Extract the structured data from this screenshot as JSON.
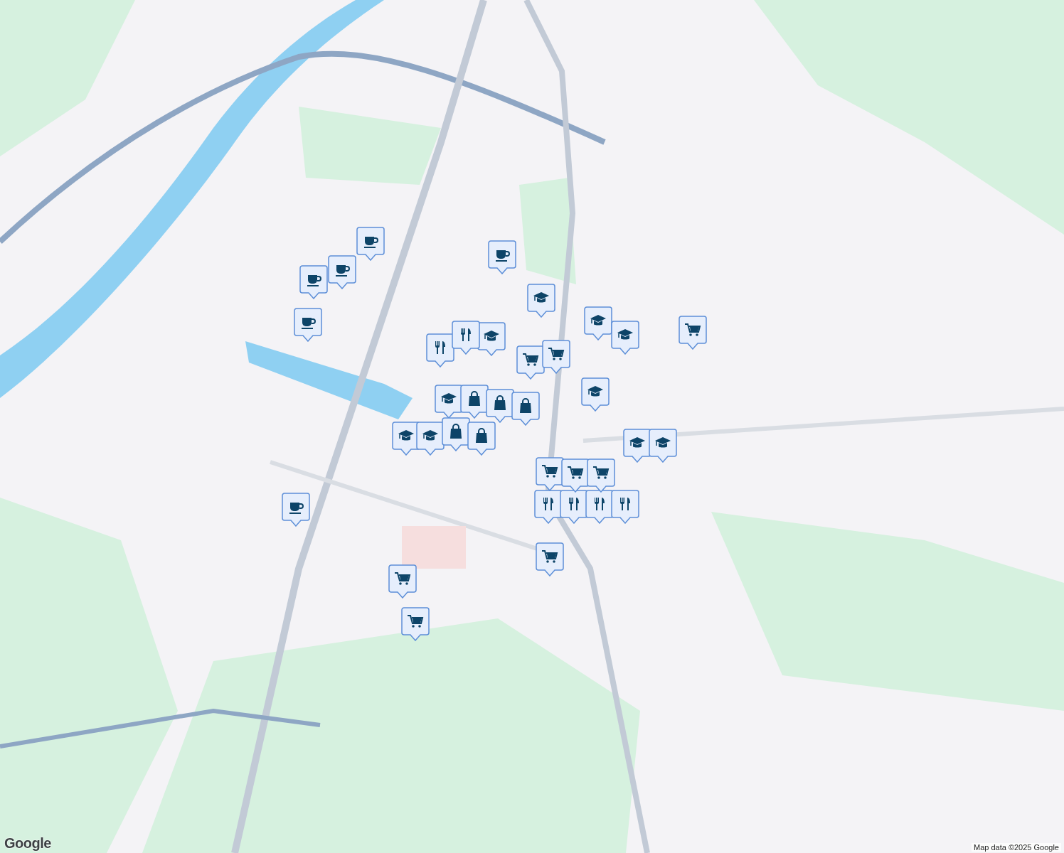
{
  "map": {
    "pins": [
      {
        "kind": "cafe"
      },
      {
        "kind": "cafe"
      },
      {
        "kind": "cafe"
      },
      {
        "kind": "cafe"
      },
      {
        "kind": "cafe"
      },
      {
        "kind": "cafe"
      },
      {
        "kind": "school"
      },
      {
        "kind": "school"
      },
      {
        "kind": "school"
      },
      {
        "kind": "school"
      },
      {
        "kind": "school"
      },
      {
        "kind": "school"
      },
      {
        "kind": "school"
      },
      {
        "kind": "school"
      },
      {
        "kind": "school"
      },
      {
        "kind": "school"
      },
      {
        "kind": "restaurant"
      },
      {
        "kind": "restaurant"
      },
      {
        "kind": "restaurant"
      },
      {
        "kind": "restaurant"
      },
      {
        "kind": "restaurant"
      },
      {
        "kind": "restaurant"
      },
      {
        "kind": "grocery"
      },
      {
        "kind": "grocery"
      },
      {
        "kind": "grocery"
      },
      {
        "kind": "grocery"
      },
      {
        "kind": "grocery"
      },
      {
        "kind": "grocery"
      },
      {
        "kind": "grocery"
      },
      {
        "kind": "grocery"
      },
      {
        "kind": "grocery"
      },
      {
        "kind": "shop"
      },
      {
        "kind": "shop"
      },
      {
        "kind": "shop"
      },
      {
        "kind": "shop"
      },
      {
        "kind": "shop"
      }
    ]
  },
  "logo": "Google",
  "attribution": "Map data ©2025 Google"
}
